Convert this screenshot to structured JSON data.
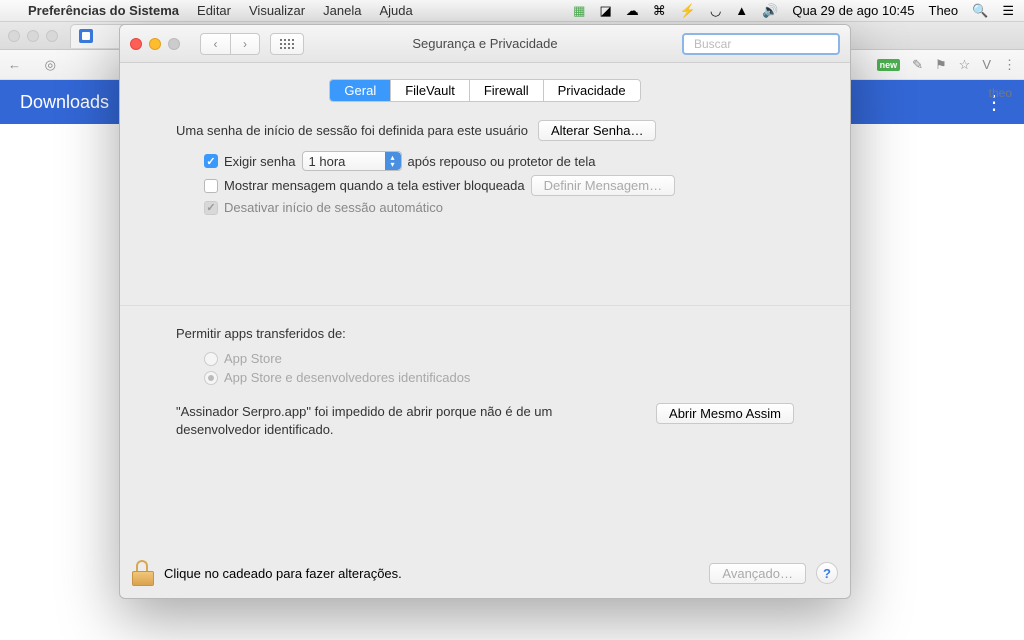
{
  "menubar": {
    "appname": "Preferências do Sistema",
    "items": [
      "Editar",
      "Visualizar",
      "Janela",
      "Ajuda"
    ],
    "datetime": "Qua 29 de ago 10:45",
    "username": "Theo"
  },
  "chrome": {
    "blue_banner": "Downloads",
    "user": "theo"
  },
  "prefs": {
    "title": "Segurança e Privacidade",
    "search_placeholder": "Buscar",
    "tabs": {
      "geral": "Geral",
      "filevault": "FileVault",
      "firewall": "Firewall",
      "privacidade": "Privacidade"
    },
    "login_password_text": "Uma senha de início de sessão foi definida para este usuário",
    "change_password_btn": "Alterar Senha…",
    "require_password_label": "Exigir senha",
    "require_password_delay": "1 hora",
    "require_password_after": "após repouso ou protetor de tela",
    "show_message_label": "Mostrar mensagem quando a tela estiver bloqueada",
    "set_message_btn": "Definir Mensagem…",
    "disable_autologin_label": "Desativar início de sessão automático",
    "allow_apps_label": "Permitir apps transferidos de:",
    "radio_appstore": "App Store",
    "radio_identified": "App Store e desenvolvedores identificados",
    "blocked_text": "\"Assinador Serpro.app\" foi impedido de abrir porque não é de um desenvolvedor identificado.",
    "open_anyway_btn": "Abrir Mesmo Assim",
    "lock_text": "Clique no cadeado para fazer alterações.",
    "advanced_btn": "Avançado…"
  }
}
